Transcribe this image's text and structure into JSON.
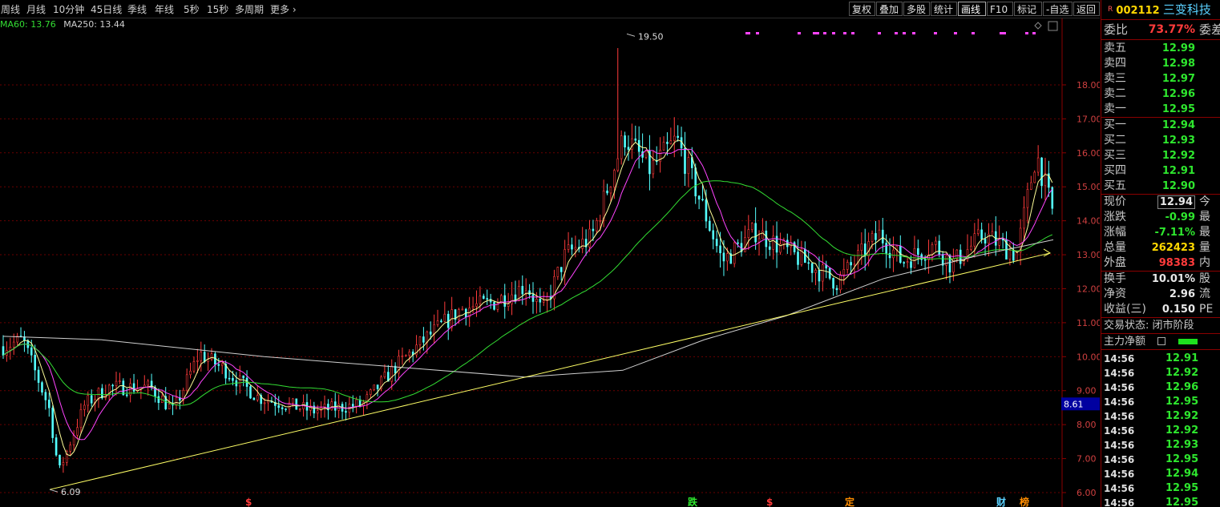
{
  "toolbar": {
    "periods": [
      "周线",
      "月线",
      "10分钟",
      "45日线",
      "季线",
      "年线",
      "5秒",
      "15秒",
      "多周期",
      "更多"
    ],
    "tools": [
      "复权",
      "叠加",
      "多股",
      "统计",
      "画线",
      "F10",
      "标记",
      "-自选",
      "返回"
    ]
  },
  "ma_legend": {
    "ma60": "MA60: 13.76",
    "ma250": "MA250: 13.44"
  },
  "chart_data": {
    "type": "candlestick",
    "yaxis_ticks": [
      "6.00",
      "7.00",
      "8.00",
      "9.00",
      "10.00",
      "11.00",
      "12.00",
      "13.00",
      "14.00",
      "15.00",
      "16.00",
      "17.00",
      "18.00"
    ],
    "ylim": [
      5.8,
      19.9
    ],
    "price_marker": "8.61",
    "annotations": [
      {
        "label": "19.50",
        "value": 19.5
      },
      {
        "label": "6.09",
        "value": 6.09
      }
    ],
    "event_markers": [
      "$",
      "跌",
      "$",
      "定",
      "财",
      "榜"
    ],
    "series": [
      {
        "name": "MA60",
        "last": 13.76
      },
      {
        "name": "MA250",
        "last": 13.44
      }
    ],
    "colors": {
      "up": "#ff3b3b",
      "down": "#54ffff",
      "ma_fast": "#ffff99",
      "ma_mid": "#ff44ff",
      "ma60": "#33dd33",
      "ma250": "#d0d0d0",
      "trend": "#ffff66"
    }
  },
  "side": {
    "badge": "R",
    "code": "002112",
    "name": "三变科技",
    "weibi_label": "委比",
    "weibi_value": "73.77%",
    "weibi_tail": "委差",
    "sell": [
      {
        "label": "卖五",
        "price": "12.99"
      },
      {
        "label": "卖四",
        "price": "12.98"
      },
      {
        "label": "卖三",
        "price": "12.97"
      },
      {
        "label": "卖二",
        "price": "12.96"
      },
      {
        "label": "卖一",
        "price": "12.95"
      }
    ],
    "buy": [
      {
        "label": "买一",
        "price": "12.94"
      },
      {
        "label": "买二",
        "price": "12.93"
      },
      {
        "label": "买三",
        "price": "12.92"
      },
      {
        "label": "买四",
        "price": "12.91"
      },
      {
        "label": "买五",
        "price": "12.90"
      }
    ],
    "quote": [
      {
        "label": "现价",
        "value": "12.94",
        "tail": "今"
      },
      {
        "label": "涨跌",
        "value": "-0.99",
        "tail": "最"
      },
      {
        "label": "涨幅",
        "value": "-7.11%",
        "tail": "最"
      },
      {
        "label": "总量",
        "value": "262423",
        "tail": "量"
      },
      {
        "label": "外盘",
        "value": "98383",
        "tail": "内"
      }
    ],
    "fin": [
      {
        "label": "换手",
        "value": "10.01%",
        "tail": "股"
      },
      {
        "label": "净资",
        "value": "2.96",
        "tail": "流"
      },
      {
        "label": "收益(三)",
        "value": "0.150",
        "tail": "PE"
      }
    ],
    "status": "交易状态: 闭市阶段",
    "capital": "主力净额",
    "ticks": [
      {
        "time": "14:56",
        "price": "12.91"
      },
      {
        "time": "14:56",
        "price": "12.92"
      },
      {
        "time": "14:56",
        "price": "12.96"
      },
      {
        "time": "14:56",
        "price": "12.95"
      },
      {
        "time": "14:56",
        "price": "12.92"
      },
      {
        "time": "14:56",
        "price": "12.92"
      },
      {
        "time": "14:56",
        "price": "12.93"
      },
      {
        "time": "14:56",
        "price": "12.95"
      },
      {
        "time": "14:56",
        "price": "12.94"
      },
      {
        "time": "14:56",
        "price": "12.95"
      },
      {
        "time": "14:56",
        "price": "12.95"
      }
    ]
  }
}
